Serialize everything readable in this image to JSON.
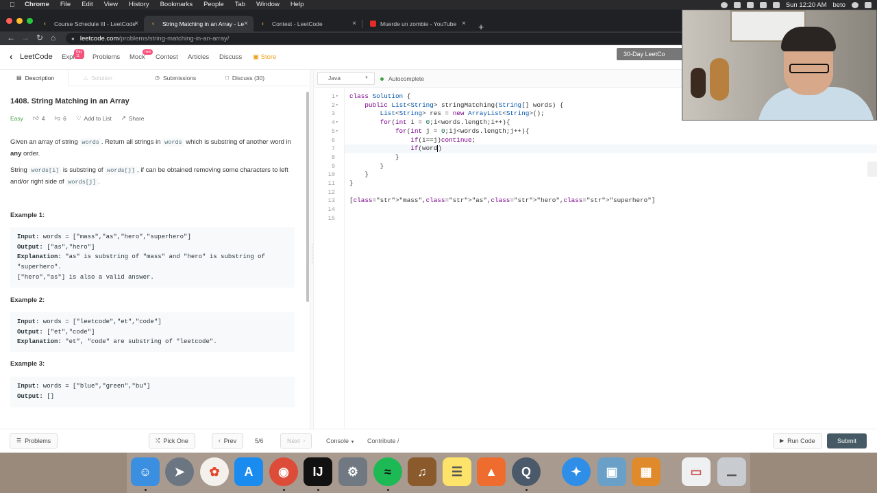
{
  "menubar": {
    "items": [
      "Chrome",
      "File",
      "Edit",
      "View",
      "History",
      "Bookmarks",
      "People",
      "Tab",
      "Window",
      "Help"
    ],
    "clock": "Sun 12:20 AM",
    "user": "beto"
  },
  "browser": {
    "tabs": [
      {
        "title": "Course Schedule III - LeetCode",
        "icon": "leetcode-icon"
      },
      {
        "title": "String Matching in an Array - Le",
        "icon": "leetcode-icon"
      },
      {
        "title": "Contest - LeetCode",
        "icon": "leetcode-icon"
      },
      {
        "title": "Muerde un zombie - YouTube",
        "icon": "youtube-icon"
      }
    ],
    "url_host": "leetcode.com",
    "url_path": "/problems/string-matching-in-an-array/"
  },
  "lcnav": {
    "logo": "LeetCode",
    "items": [
      "Explore",
      "Problems",
      "Mock",
      "Contest",
      "Articles",
      "Discuss",
      "Store"
    ],
    "explore_badge": "Day 11",
    "mock_badge": "new",
    "promo": "30-Day LeetCo"
  },
  "lefttabs": [
    "Description",
    "Solution",
    "Submissions",
    "Discuss (30)"
  ],
  "problem": {
    "title": "1408. String Matching in an Array",
    "difficulty": "Easy",
    "likes": "4",
    "dislikes": "6",
    "add_to_list": "Add to List",
    "share": "Share",
    "p1a": "Given an array of string ",
    "p1code": "words",
    "p1b": ". Return all strings in ",
    "p1code2": "words",
    "p1c": " which is substring of another word in ",
    "p1bold": "any",
    "p1d": " order.",
    "p2a": "String ",
    "p2code": "words[i]",
    "p2b": " is substring of ",
    "p2code2": "words[j]",
    "p2c": ", if can be obtained removing some characters to left and/or right side of ",
    "p2code3": "words[j]",
    "p2d": ".",
    "examples": [
      {
        "heading": "Example 1:",
        "lines": [
          {
            "label": "Input:",
            "text": " words = [\"mass\",\"as\",\"hero\",\"superhero\"]"
          },
          {
            "label": "Output:",
            "text": " [\"as\",\"hero\"]"
          },
          {
            "label": "Explanation:",
            "text": " \"as\" is substring of \"mass\" and \"hero\" is substring of"
          },
          {
            "label": "",
            "text": "\"superhero\"."
          },
          {
            "label": "",
            "text": "[\"hero\",\"as\"] is also a valid answer."
          }
        ]
      },
      {
        "heading": "Example 2:",
        "lines": [
          {
            "label": "Input:",
            "text": " words = [\"leetcode\",\"et\",\"code\"]"
          },
          {
            "label": "Output:",
            "text": " [\"et\",\"code\"]"
          },
          {
            "label": "Explanation:",
            "text": " \"et\", \"code\" are substring of \"leetcode\"."
          }
        ]
      },
      {
        "heading": "Example 3:",
        "lines": [
          {
            "label": "Input:",
            "text": " words = [\"blue\",\"green\",\"bu\"]"
          },
          {
            "label": "Output:",
            "text": " []"
          }
        ]
      }
    ]
  },
  "editor": {
    "language": "Java",
    "autocomplete": "Autocomplete",
    "line_numbers": [
      "1",
      "2",
      "3",
      "4",
      "5",
      "6",
      "7",
      "8",
      "9",
      "10",
      "11",
      "12",
      "13",
      "14",
      "15"
    ],
    "folded_lines": [
      1,
      2,
      4,
      5
    ],
    "current_line": 7,
    "code": [
      "class Solution {",
      "    public List<String> stringMatching(String[] words) {",
      "        List<String> res = new ArrayList<String>();",
      "        for(int i = 0;i<words.length;i++){",
      "            for(int j = 0;ij<words.length;j++){",
      "                if(i==j)continue;",
      "                if(word)",
      "            }",
      "        }",
      "    }",
      "}",
      "",
      "[\"mass\",\"as\",\"hero\",\"superhero\"]",
      "",
      ""
    ]
  },
  "bottombar": {
    "problems": "Problems",
    "pick_one": "Pick One",
    "prev": "Prev",
    "page": "5/6",
    "next": "Next",
    "console": "Console",
    "contribute": "Contribute",
    "run_code": "Run Code",
    "submit": "Submit"
  },
  "dock": [
    "finder-icon",
    "launchpad-icon",
    "photos-icon",
    "app-store-icon",
    "chrome-icon",
    "intellij-icon",
    "system-preferences-icon",
    "spotify-icon",
    "garageband-icon",
    "notes-icon",
    "mindnode-icon",
    "quicktime-icon",
    "safari-icon",
    "preview-icon",
    "calculator-icon",
    "screenshot-icon",
    "trash-icon"
  ],
  "colors": {
    "accent": "#455a64",
    "easy": "#43a047",
    "store": "#f0a020"
  }
}
